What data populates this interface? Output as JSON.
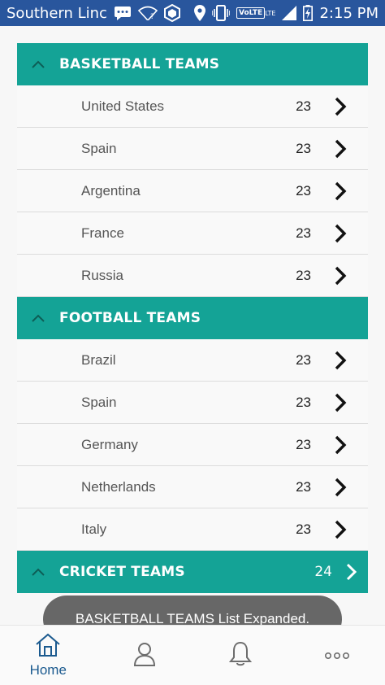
{
  "status_bar": {
    "carrier": "Southern Linc",
    "volte": "VoLTE",
    "lte": "LTE",
    "time": "2:15 PM",
    "icons": [
      "message-icon",
      "wifi-question-icon",
      "hexagon-app-icon",
      "location-icon",
      "vibrate-icon",
      "volte-icon",
      "signal-icon",
      "battery-charging-icon"
    ]
  },
  "groups": [
    {
      "title": "BASKETBALL TEAMS",
      "expanded": true,
      "items": [
        {
          "name": "United States",
          "count": "23"
        },
        {
          "name": "Spain",
          "count": "23"
        },
        {
          "name": "Argentina",
          "count": "23"
        },
        {
          "name": "France",
          "count": "23"
        },
        {
          "name": "Russia",
          "count": "23"
        }
      ]
    },
    {
      "title": "FOOTBALL TEAMS",
      "expanded": true,
      "items": [
        {
          "name": "Brazil",
          "count": "23"
        },
        {
          "name": "Spain",
          "count": "23"
        },
        {
          "name": "Germany",
          "count": "23"
        },
        {
          "name": "Netherlands",
          "count": "23"
        },
        {
          "name": "Italy",
          "count": "23"
        }
      ]
    },
    {
      "title": "CRICKET TEAMS",
      "expanded": false,
      "count": "24"
    }
  ],
  "toast": "BASKETBALL TEAMS List Expanded.",
  "bottom_nav": {
    "items": [
      {
        "label": "Home",
        "icon": "home-icon",
        "active": true
      },
      {
        "label": "",
        "icon": "profile-icon",
        "active": false
      },
      {
        "label": "",
        "icon": "bell-icon",
        "active": false
      },
      {
        "label": "",
        "icon": "more-icon",
        "active": false
      }
    ]
  },
  "colors": {
    "status_bar": "#29569d",
    "group_header": "#14a396",
    "nav_active": "#1b5a8f"
  }
}
